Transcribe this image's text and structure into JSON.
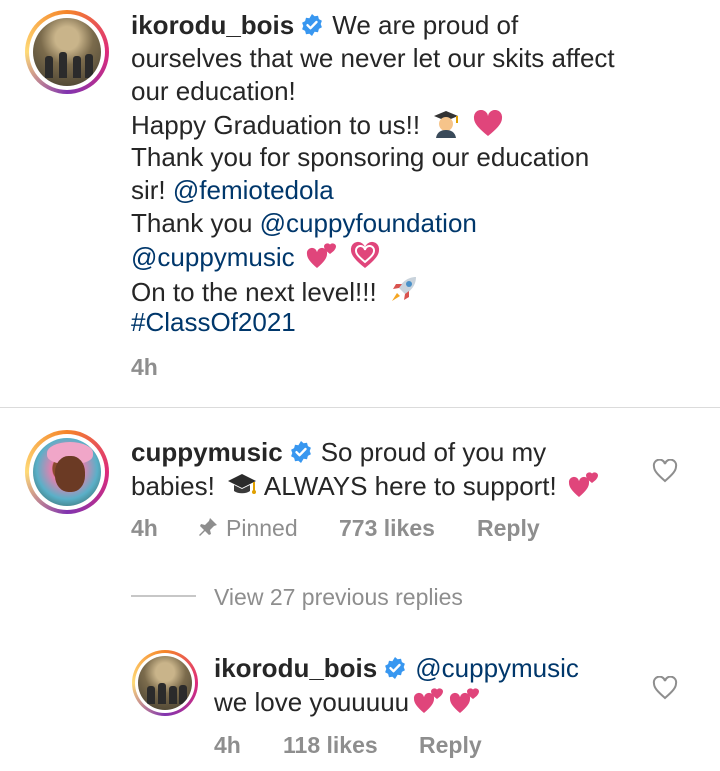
{
  "caption": {
    "username": "ikorodu_bois",
    "first_line": "We are proud of",
    "line2": "ourselves that we never let our skits affect",
    "line3": "our education!",
    "line4": "Happy Graduation to us!!",
    "line5": "Thank you for sponsoring our education",
    "line6_text": "sir! ",
    "mention_femi": "@femiotedola",
    "line7_text": "Thank you ",
    "mention_cuppyfoundation": "@cuppyfoundation",
    "mention_cuppymusic": "@cuppymusic",
    "line9": "On to the next level!!!",
    "hashtag": "#ClassOf2021",
    "time": "4h"
  },
  "comment": {
    "username": "cuppymusic",
    "first_line": "So proud of you my",
    "line2a": "babies!",
    "line2b": "ALWAYS here to support!",
    "time": "4h",
    "pinned": "Pinned",
    "likes": "773 likes",
    "reply": "Reply",
    "view_replies": "View 27 previous replies"
  },
  "reply": {
    "username": "ikorodu_bois",
    "mention": "@cuppymusic",
    "line2": "we love youuuuu",
    "time": "4h",
    "likes": "118 likes",
    "reply": "Reply"
  },
  "colors": {
    "link": "#00376b",
    "verified": "#3897f0",
    "muted": "#8e8e8e",
    "heart_emoji": "#e0457b"
  },
  "icons": [
    "verified-badge-icon",
    "graduate-emoji-icon",
    "heart-emoji-icon",
    "two-hearts-emoji-icon",
    "sparkling-heart-emoji-icon",
    "rocket-emoji-icon",
    "graduation-cap-emoji-icon",
    "pin-icon",
    "like-heart-icon"
  ]
}
